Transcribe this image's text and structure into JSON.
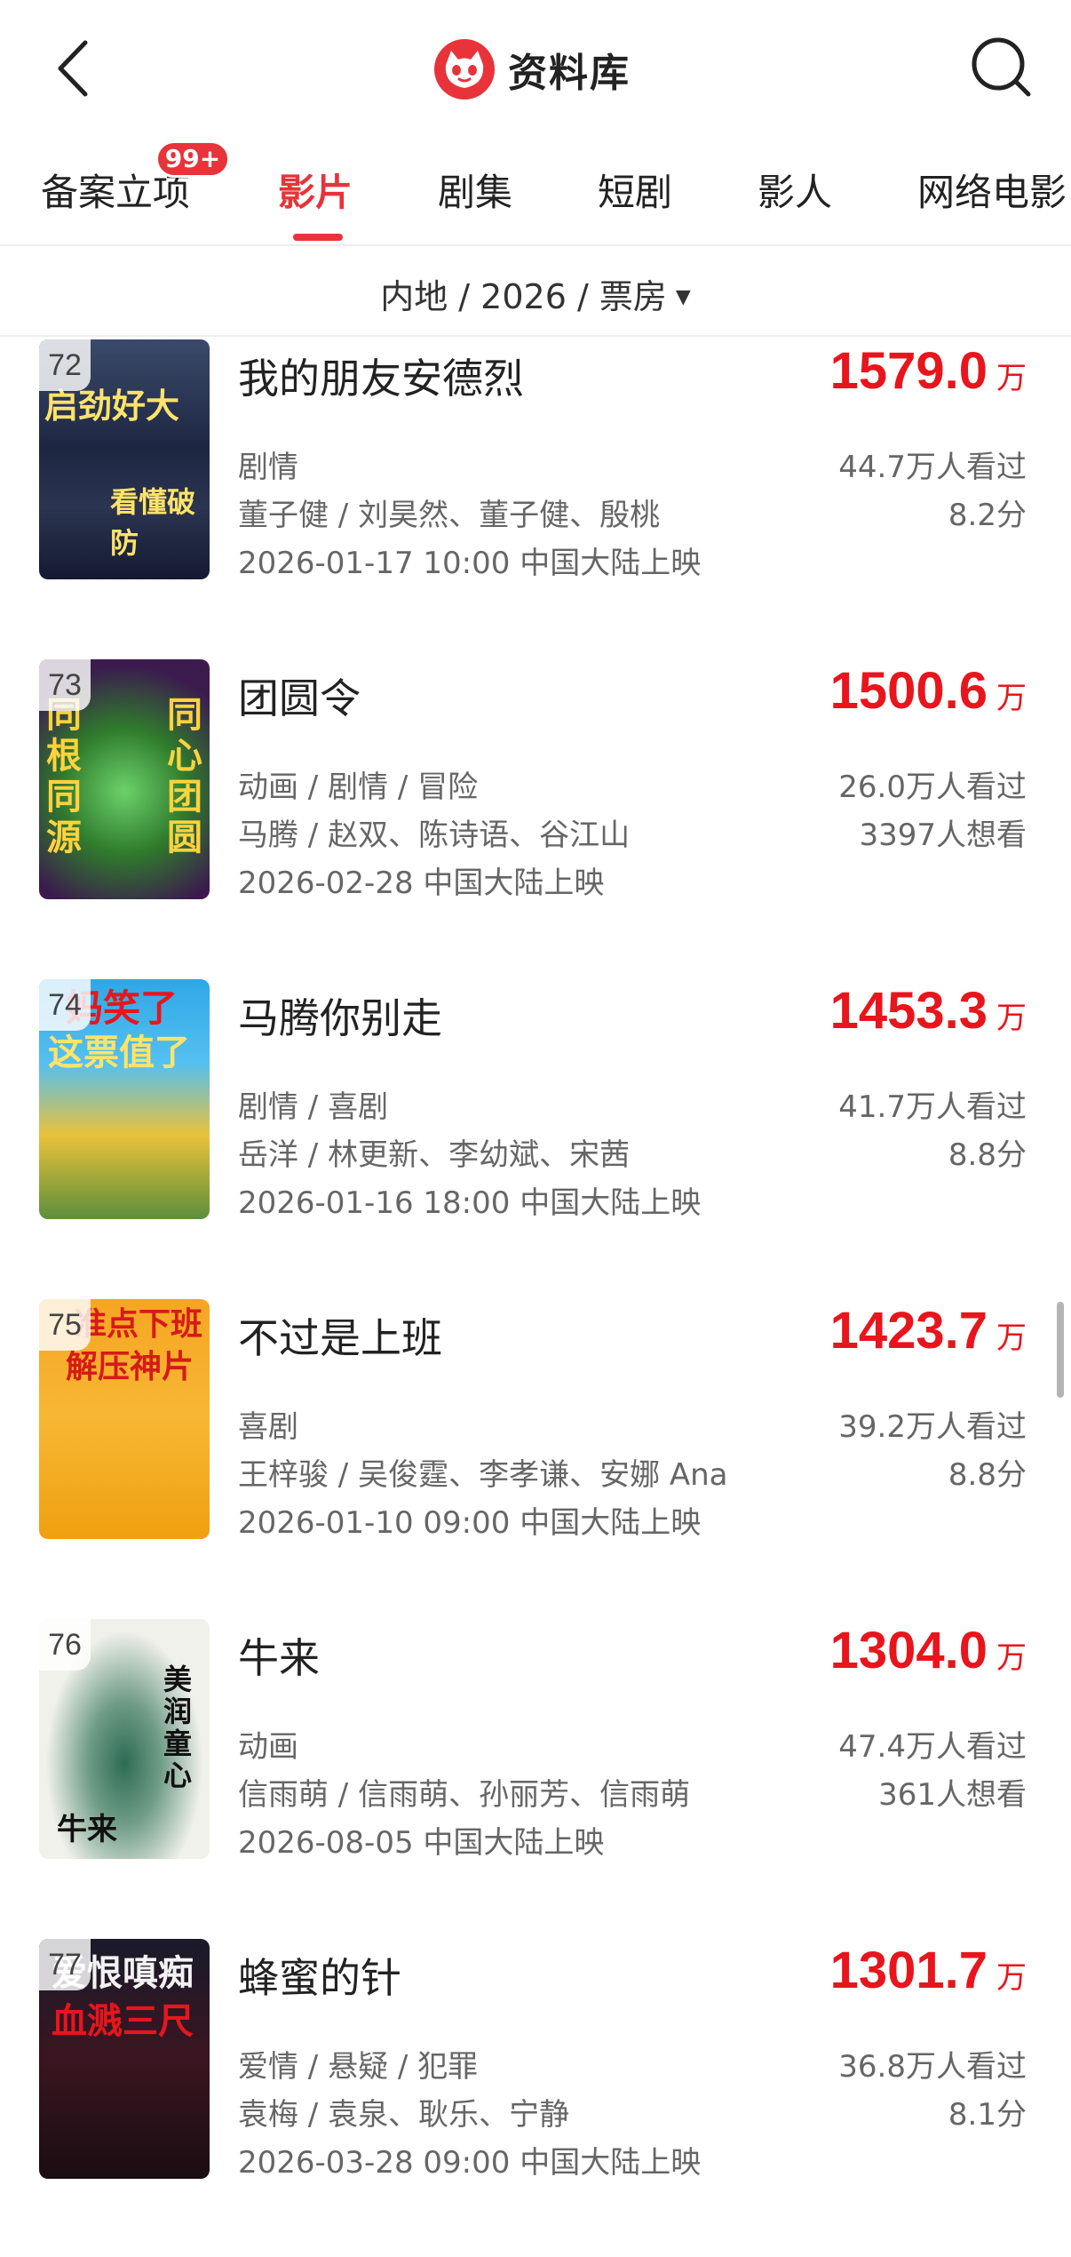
{
  "header": {
    "title": "资料库"
  },
  "tabs": [
    {
      "label": "备案立项",
      "badge": "99+"
    },
    {
      "label": "影片"
    },
    {
      "label": "剧集"
    },
    {
      "label": "短剧"
    },
    {
      "label": "影人"
    },
    {
      "label": "网络电影"
    }
  ],
  "filter": {
    "label": "内地 / 2026 / 票房"
  },
  "colors": {
    "accent": "#e8333b",
    "box_office": "#e8151c"
  },
  "unit": "万",
  "movies": [
    {
      "rank": "72",
      "title": "我的朋友安德烈",
      "box_office": "1579.0",
      "genre": "剧情",
      "credits": "董子健 / 刘昊然、董子健、殷桃",
      "release": "2026-01-17 10:00 中国大陆上映",
      "watched": "44.7万人看过",
      "score": "8.2分",
      "poster_text": [
        "启劲好大",
        "看懂破防"
      ]
    },
    {
      "rank": "73",
      "title": "团圆令",
      "box_office": "1500.6",
      "genre": "动画 / 剧情 / 冒险",
      "credits": "马腾 / 赵双、陈诗语、谷江山",
      "release": "2026-02-28 中国大陆上映",
      "watched": "26.0万人看过",
      "score": "3397人想看",
      "poster_text": [
        "同根同源",
        "同心团圆"
      ]
    },
    {
      "rank": "74",
      "title": "马腾你别走",
      "box_office": "1453.3",
      "genre": "剧情 / 喜剧",
      "credits": "岳洋 / 林更新、李幼斌、宋茜",
      "release": "2026-01-16 18:00 中国大陆上映",
      "watched": "41.7万人看过",
      "score": "8.8分",
      "poster_text": [
        "妈笑了",
        "这票值了"
      ]
    },
    {
      "rank": "75",
      "title": "不过是上班",
      "box_office": "1423.7",
      "genre": "喜剧",
      "credits": "王梓骏 / 吴俊霆、李孝谦、安娜 Ana",
      "release": "2026-01-10 09:00 中国大陆上映",
      "watched": "39.2万人看过",
      "score": "8.8分",
      "poster_text": [
        "准点下班",
        "解压神片"
      ]
    },
    {
      "rank": "76",
      "title": "牛来",
      "box_office": "1304.0",
      "genre": "动画",
      "credits": "信雨萌 / 信雨萌、孙丽芳、信雨萌",
      "release": "2026-08-05 中国大陆上映",
      "watched": "47.4万人看过",
      "score": "361人想看",
      "poster_text": [
        "美润童心",
        "牛来"
      ]
    },
    {
      "rank": "77",
      "title": "蜂蜜的针",
      "box_office": "1301.7",
      "genre": "爱情 / 悬疑 / 犯罪",
      "credits": "袁梅 / 袁泉、耿乐、宁静",
      "release": "2026-03-28 09:00 中国大陆上映",
      "watched": "36.8万人看过",
      "score": "8.1分",
      "poster_text": [
        "爱恨嗔痴",
        "血溅三尺"
      ]
    }
  ]
}
